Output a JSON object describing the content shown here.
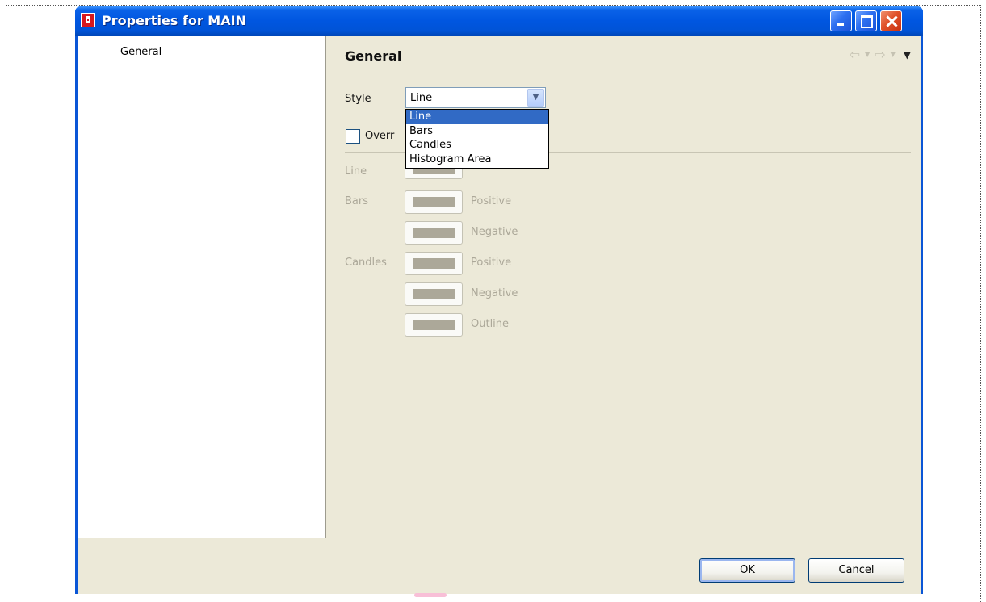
{
  "window": {
    "title": "Properties for MAIN",
    "controls": {
      "minimize": "minimize-icon",
      "maximize": "maximize-icon",
      "close": "close-icon"
    }
  },
  "tree": {
    "items": [
      {
        "label": "General"
      }
    ]
  },
  "page": {
    "header": "General",
    "nav": {
      "back": "back-arrow-icon",
      "forward": "forward-arrow-icon",
      "menu": "view-menu-icon"
    }
  },
  "style": {
    "label": "Style",
    "selected": "Line",
    "options": [
      "Line",
      "Bars",
      "Candles",
      "Histogram Area"
    ]
  },
  "override": {
    "label": "Overr",
    "checked": false
  },
  "colors": {
    "line_label": "Line",
    "bars_label": "Bars",
    "candles_label": "Candles",
    "positive": "Positive",
    "negative": "Negative",
    "outline": "Outline",
    "swatch_color": "#aca899"
  },
  "buttons": {
    "ok": "OK",
    "cancel": "Cancel"
  },
  "theme": {
    "titlebar": "#0054e3",
    "selection": "#316ac5",
    "window_bg": "#ece9d8"
  }
}
